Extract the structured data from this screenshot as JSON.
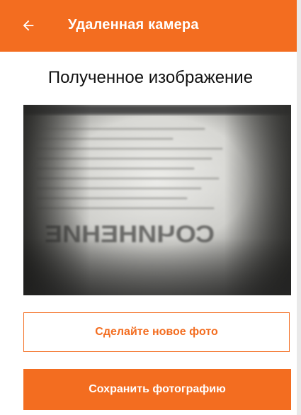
{
  "app_bar": {
    "title": "Удаленная камера",
    "back_icon": "arrow-left-icon",
    "background": "#f36d20"
  },
  "main": {
    "heading": "Полученное изображение",
    "image": {
      "content": "Mirrored photo of a page with blurred text lines"
    },
    "retake_button_label": "Сделайте новое фото",
    "save_button_label": "Сохранить фотографию"
  },
  "colors": {
    "accent": "#f36d20",
    "text": "#111111",
    "background": "#ffffff"
  }
}
